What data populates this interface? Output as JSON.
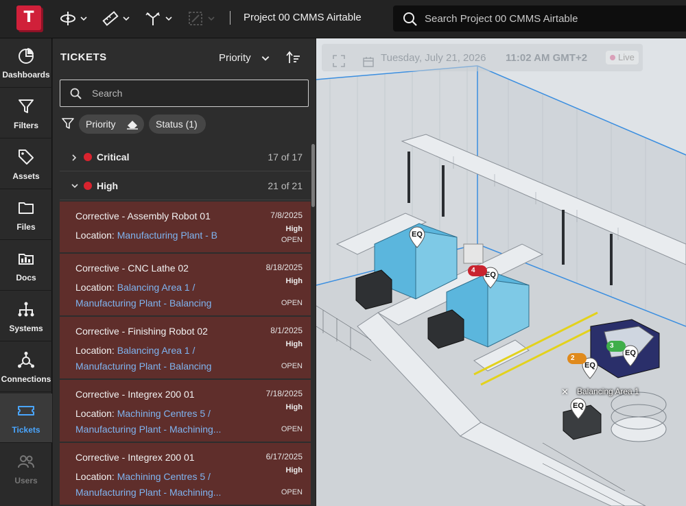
{
  "app": {
    "logo_letter": "T",
    "project_title": "Project 00 CMMS Airtable",
    "search_placeholder": "Search Project 00 CMMS Airtable"
  },
  "toolbar": {
    "icons": [
      "orbit-icon",
      "measure-ruler-icon",
      "section-axes-icon",
      "selection-box-icon"
    ]
  },
  "nav": {
    "items": [
      {
        "label": "Dashboards",
        "icon": "dashboard-icon"
      },
      {
        "label": "Filters",
        "icon": "filter-icon"
      },
      {
        "label": "Assets",
        "icon": "tag-icon"
      },
      {
        "label": "Files",
        "icon": "folder-icon"
      },
      {
        "label": "Docs",
        "icon": "docs-icon"
      },
      {
        "label": "Systems",
        "icon": "systems-icon"
      },
      {
        "label": "Connections",
        "icon": "connections-icon"
      },
      {
        "label": "Tickets",
        "icon": "ticket-icon",
        "active": true
      },
      {
        "label": "Users",
        "icon": "users-icon",
        "disabled": true
      }
    ]
  },
  "tickets": {
    "title": "TICKETS",
    "sort_by": "Priority",
    "search_placeholder": "Search",
    "chips": {
      "priority": "Priority",
      "status": "Status (1)"
    },
    "groups": [
      {
        "name": "Critical",
        "count": "17 of 17",
        "expanded": false
      },
      {
        "name": "High",
        "count": "21 of 21",
        "expanded": true
      }
    ],
    "items": [
      {
        "title": "Corrective - Assembly Robot 01",
        "location_label": "Location:",
        "location": "Manufacturing Plant - B",
        "date": "7/8/2025",
        "priority": "High",
        "status": "OPEN"
      },
      {
        "title": "Corrective - CNC Lathe 02",
        "location_label": "Location:",
        "location": "Balancing Area 1 /",
        "location2": "Manufacturing Plant - Balancing",
        "date": "8/18/2025",
        "priority": "High",
        "status": "OPEN"
      },
      {
        "title": "Corrective - Finishing Robot 02",
        "location_label": "Location:",
        "location": "Balancing Area 1 /",
        "location2": "Manufacturing Plant - Balancing",
        "date": "8/1/2025",
        "priority": "High",
        "status": "OPEN"
      },
      {
        "title": "Corrective - Integrex 200 01",
        "location_label": "Location:",
        "location": "Machining Centres 5 /",
        "location2": "Manufacturing Plant - Machining...",
        "date": "7/18/2025",
        "priority": "High",
        "status": "OPEN"
      },
      {
        "title": "Corrective - Integrex 200 01",
        "location_label": "Location:",
        "location": "Machining Centres 5 /",
        "location2": "Manufacturing Plant - Machining...",
        "date": "6/17/2025",
        "priority": "High",
        "status": "OPEN"
      }
    ]
  },
  "viewport": {
    "date": "Tuesday, July 21, 2026",
    "time": "11:02 AM GMT+2",
    "live": "Live",
    "area_label": "Balancing Area 1",
    "area_close": "✕",
    "pins": [
      "EQ",
      "EQ",
      "EQ",
      "EQ",
      "EQ"
    ],
    "badges": [
      "4",
      "3",
      "2"
    ]
  },
  "colors": {
    "accent": "#4aa6ff",
    "ticket_bg": "#5f2e2b",
    "critical_dot": "#d9232e",
    "brand": "#d0203a"
  }
}
